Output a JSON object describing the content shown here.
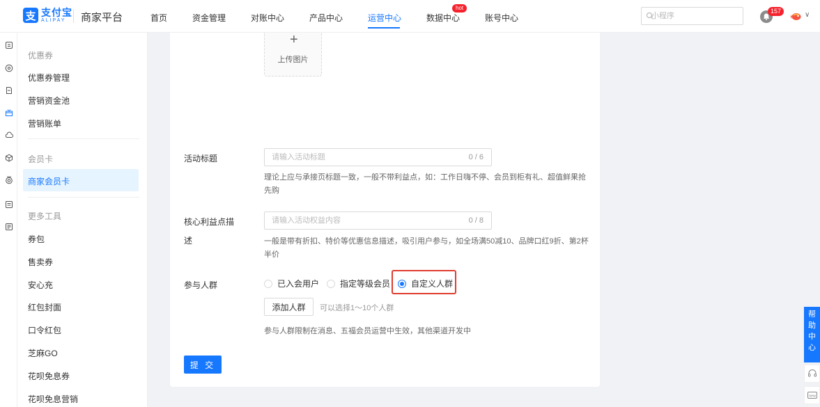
{
  "header": {
    "logo_text": "支付宝",
    "logo_en": "ALIPAY",
    "logo_mark": "支",
    "platform": "商家平台",
    "nav": [
      {
        "label": "首页"
      },
      {
        "label": "资金管理"
      },
      {
        "label": "对账中心"
      },
      {
        "label": "产品中心"
      },
      {
        "label": "运营中心",
        "active": true
      },
      {
        "label": "数据中心",
        "badge": "hot"
      },
      {
        "label": "账号中心"
      }
    ],
    "search_placeholder": "小程序",
    "notification_count": "157"
  },
  "icon_rail": [
    "home-icon",
    "compass-icon",
    "document-icon",
    "gift-icon",
    "cloud-icon",
    "cube-icon",
    "target-icon",
    "list-icon",
    "file-icon"
  ],
  "submenu": {
    "groups": [
      {
        "title": "优惠券",
        "items": [
          "优惠券管理",
          "营销资金池",
          "营销账单"
        ]
      },
      {
        "title": "会员卡",
        "items": [
          "商家会员卡"
        ]
      },
      {
        "title": "更多工具",
        "items": [
          "券包",
          "售卖券",
          "安心充",
          "红包封面",
          "口令红包",
          "芝麻GO",
          "花呗免息券",
          "花呗免息营销"
        ]
      }
    ],
    "active_item": "商家会员卡"
  },
  "form": {
    "upload_label": "上传图片",
    "upload_plus": "+",
    "title_field": {
      "label": "活动标题",
      "placeholder": "请输入活动标题",
      "counter": "0 / 6",
      "help": "理论上应与承接页标题一致，一般不带利益点，如：工作日嗨不停、会员到柜有礼、超值鲜果抢先购"
    },
    "benefit_field": {
      "label_line1": "核心利益点描",
      "label_line2": "述",
      "placeholder": "请输入活动权益内容",
      "counter": "0 / 8",
      "help": "一般是带有折扣、特价等优惠信息描述，吸引用户参与，如全场满50减10、品牌口红9折、第2杯半价"
    },
    "audience": {
      "label": "参与人群",
      "options": [
        {
          "label": "已入会用户",
          "checked": false
        },
        {
          "label": "指定等级会员",
          "checked": false
        },
        {
          "label": "自定义人群",
          "checked": true
        }
      ],
      "add_button": "添加人群",
      "add_hint": "可以选择1～10个人群",
      "note": "参与人群限制在消息、五福会员运营中生效，其他渠道开发中"
    },
    "submit_label": "提 交"
  },
  "help_float": {
    "chars": [
      "帮",
      "助",
      "中",
      "心"
    ],
    "new_label": "new"
  },
  "colors": {
    "primary": "#1677ff",
    "highlight": "#e03c2e",
    "badge": "#f5222d"
  }
}
